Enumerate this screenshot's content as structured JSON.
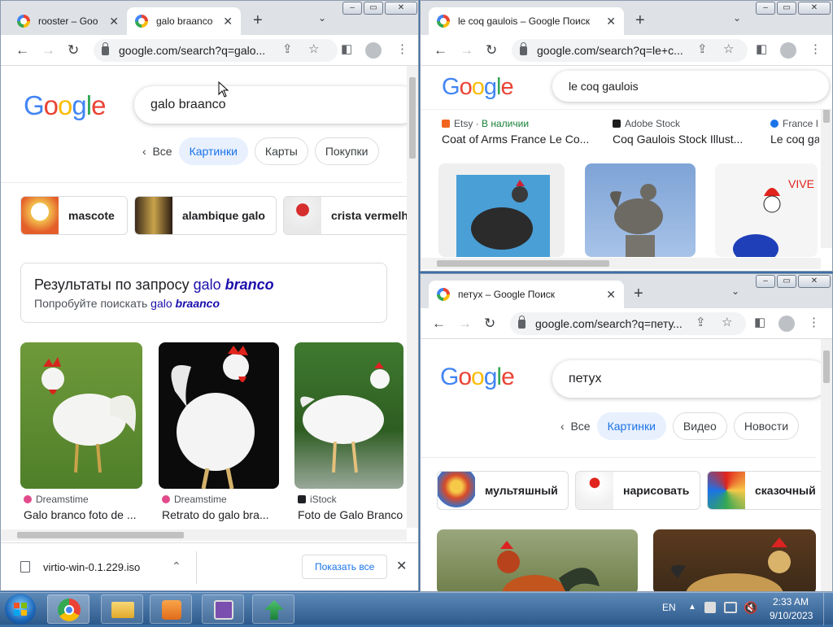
{
  "left_window": {
    "tabs": [
      {
        "title": "rooster – Goo",
        "close": "✕"
      },
      {
        "title": "galo braanco",
        "close": "✕"
      }
    ],
    "url": "google.com/search?q=galo...",
    "logo": "Google",
    "query": "galo braanco",
    "filters": {
      "back": "Все",
      "items": [
        "Картинки",
        "Карты",
        "Покупки"
      ]
    },
    "suggestions": [
      "mascote",
      "alambique galo",
      "crista vermelh"
    ],
    "notice": {
      "line1_prefix": "Результаты по запросу ",
      "line1_plain": "galo ",
      "line1_bold": "branco",
      "line2_prefix": "Попробуйте поискать ",
      "line2_plain": "galo ",
      "line2_bold": "braanco"
    },
    "results": [
      {
        "source": "Dreamstime",
        "caption": "Galo branco foto de ..."
      },
      {
        "source": "Dreamstime",
        "caption": "Retrato do galo bra..."
      },
      {
        "source": "iStock",
        "caption": "Foto de Galo Branco"
      }
    ],
    "download": {
      "filename": "virtio-win-0.1.229.iso",
      "show_all": "Показать все"
    }
  },
  "top_right_window": {
    "tabs": [
      {
        "title": "le coq gaulois – Google Поиск",
        "close": "✕"
      }
    ],
    "url": "google.com/search?q=le+c...",
    "logo": "Google",
    "query": "le coq gaulois",
    "results": [
      {
        "source": "Etsy",
        "stock": "В наличии",
        "caption": "Coat of Arms France Le Co..."
      },
      {
        "source": "Adobe Stock",
        "caption": "Coq Gaulois Stock Illust..."
      },
      {
        "source": "France I",
        "caption": "Le coq ga"
      }
    ]
  },
  "bottom_right_window": {
    "tabs": [
      {
        "title": "петух – Google Поиск",
        "close": "✕"
      }
    ],
    "url": "google.com/search?q=пету...",
    "logo": "Google",
    "query": "петух",
    "filters": {
      "back": "Все",
      "items": [
        "Картинки",
        "Видео",
        "Новости"
      ]
    },
    "suggestions": [
      "мультяшный",
      "нарисовать",
      "сказочный"
    ]
  },
  "taskbar": {
    "language": "EN",
    "time": "2:33 AM",
    "date": "9/10/2023"
  },
  "colors": {
    "google_blue": "#1a73e8",
    "chip_selected_bg": "#e8f0fe",
    "taskbar": "#2d5a8c"
  }
}
